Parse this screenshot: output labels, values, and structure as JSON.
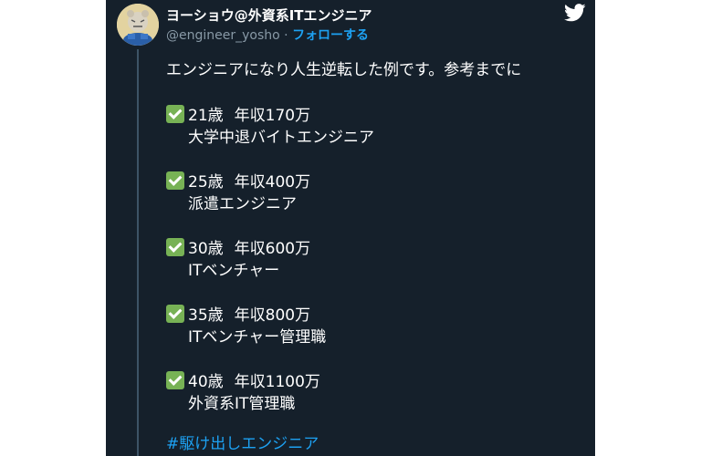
{
  "tweet": {
    "display_name": "ヨーショウ@外資系ITエンジニア",
    "handle": "@engineer_yosho",
    "separator": " · ",
    "follow_label": "フォローする",
    "intro": "エンジニアになり人生逆転した例です。参考までに",
    "entries": [
      {
        "age": "21歳",
        "income": "年収170万",
        "role": "大学中退バイトエンジニア"
      },
      {
        "age": "25歳",
        "income": "年収400万",
        "role": "派遣エンジニア"
      },
      {
        "age": "30歳",
        "income": "年収600万",
        "role": "ITベンチャー"
      },
      {
        "age": "35歳",
        "income": "年収800万",
        "role": "ITベンチャー管理職"
      },
      {
        "age": "40歳",
        "income": "年収1100万",
        "role": "外資系IT管理職"
      }
    ],
    "hashtag": "#駆け出しエンジニア"
  },
  "icons": {
    "brand": "twitter-bird-icon",
    "check": "white-check-mark-icon",
    "avatar": "tiger-mascot-avatar"
  },
  "colors": {
    "card_background": "#15202b",
    "link_blue": "#1da1f2",
    "secondary_text": "#8899a6",
    "check_green": "#77b255"
  }
}
